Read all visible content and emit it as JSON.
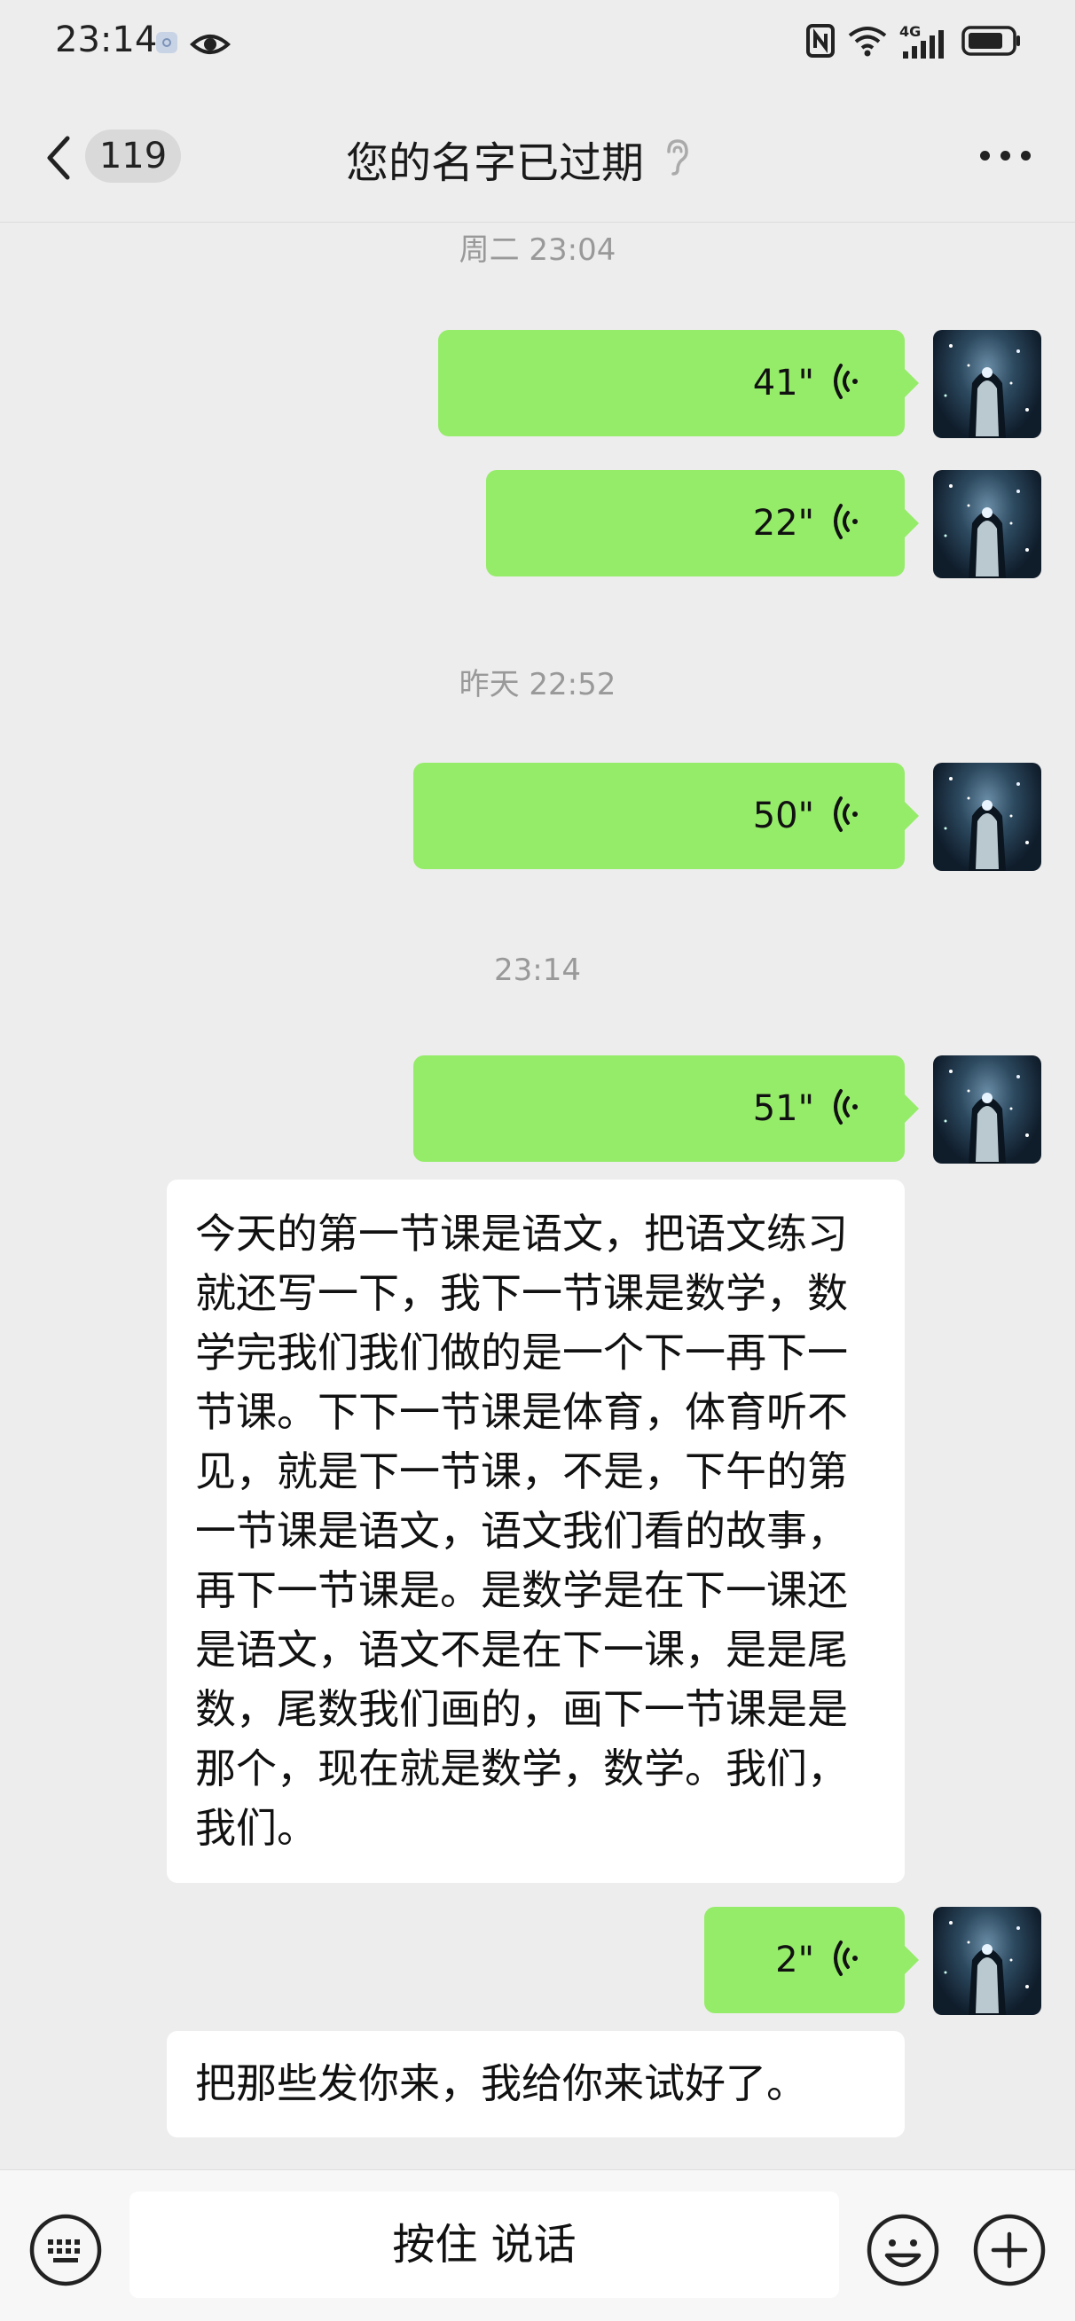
{
  "status_bar": {
    "time": "23:14",
    "icons": [
      "notification-chip-icon",
      "eye-icon",
      "nfc-icon",
      "wifi-icon",
      "4g-signal-icon",
      "battery-icon"
    ],
    "network_label": "4G"
  },
  "header": {
    "back_icon": "chevron-left-icon",
    "unread_count": "119",
    "title": "您的名字已过期",
    "title_icon": "ear-icon",
    "more_icon": "more-dots-icon"
  },
  "messages": [
    {
      "type": "timestamp",
      "text": "周二 23:04"
    },
    {
      "type": "voice",
      "side": "sent",
      "duration": "41\""
    },
    {
      "type": "voice",
      "side": "sent",
      "duration": "22\""
    },
    {
      "type": "timestamp",
      "text": "昨天 22:52"
    },
    {
      "type": "voice",
      "side": "sent",
      "duration": "50\""
    },
    {
      "type": "timestamp",
      "text": "23:14"
    },
    {
      "type": "voice",
      "side": "sent",
      "duration": "51\""
    },
    {
      "type": "text",
      "side": "received",
      "text": "今天的第一节课是语文，把语文练习就还写一下，我下一节课是数学，数学完我们我们做的是一个下一再下一节课。下下一节课是体育，体育听不见，就是下一节课，不是，下午的第一节课是语文，语文我们看的故事，再下一节课是。是数学是在下一课还是语文，语文不是在下一课，是是尾数，尾数我们画的，画下一节课是是那个，现在就是数学，数学。我们，我们。"
    },
    {
      "type": "voice",
      "side": "sent",
      "duration": "2\""
    },
    {
      "type": "text",
      "side": "received",
      "text": "把那些发你来，我给你来试好了。"
    }
  ],
  "input_bar": {
    "keyboard_icon": "keyboard-icon",
    "hold_to_talk_label": "按住 说话",
    "emoji_icon": "emoji-icon",
    "plus_icon": "plus-icon"
  },
  "colors": {
    "background": "#ededed",
    "sent_bubble": "#95ec69",
    "received_bubble": "#ffffff",
    "timestamp_text": "#999999"
  }
}
